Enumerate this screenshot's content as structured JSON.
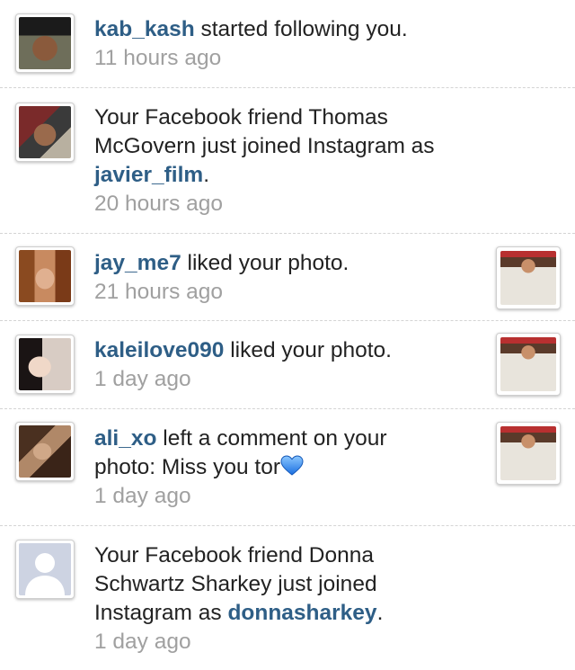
{
  "notifications": [
    {
      "type": "follow",
      "username": "kab_kash",
      "action": " started following you.",
      "time": "11 hours ago"
    },
    {
      "type": "facebook_join",
      "prefix": "Your Facebook friend Thomas",
      "line2": "McGovern just joined Instagram as",
      "username": "javier_film",
      "suffix": ".",
      "time": "20 hours ago"
    },
    {
      "type": "like",
      "username": "jay_me7",
      "action": " liked your photo.",
      "time": "21 hours ago"
    },
    {
      "type": "like",
      "username": "kaleilove090",
      "action": " liked your photo.",
      "time": "1 day ago"
    },
    {
      "type": "comment",
      "username": "ali_xo",
      "action": " left a comment on your",
      "line2": "photo: Miss you tor",
      "emoji": "blue-heart-icon",
      "time": "1 day ago"
    },
    {
      "type": "facebook_join",
      "prefix": "Your Facebook friend Donna",
      "line2": "Schwartz Sharkey just joined",
      "line3": "Instagram as ",
      "username": "donnasharkey",
      "suffix": ".",
      "time": "1 day ago"
    }
  ],
  "colors": {
    "username": "#2e5e86",
    "timestamp": "#a0a0a0",
    "text": "#222222"
  }
}
